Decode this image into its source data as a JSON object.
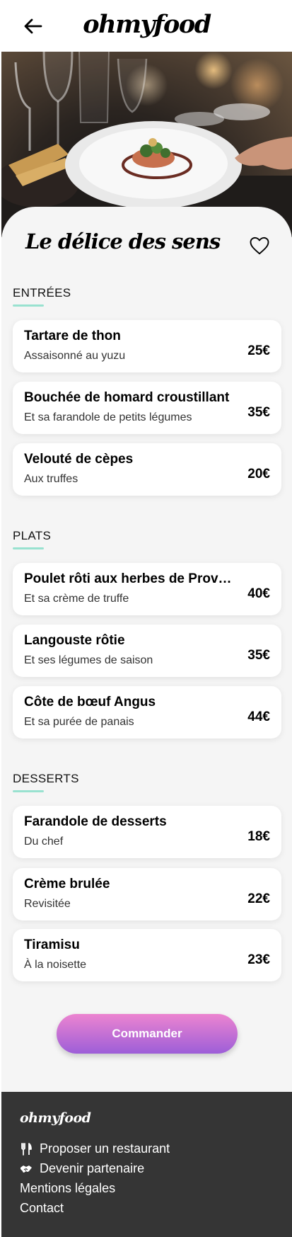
{
  "header": {
    "logo": "ohmyfood",
    "back_icon": "arrow-left-icon"
  },
  "restaurant": {
    "name": "Le délice des sens",
    "favorite_icon": "heart-outline-icon"
  },
  "sections": [
    {
      "title": "Entrées",
      "dishes": [
        {
          "name": "Tartare de thon",
          "description": "Assaisonné au yuzu",
          "price": "25€"
        },
        {
          "name": "Bouchée de homard croustillant",
          "description": "Et sa farandole de petits légumes",
          "price": "35€"
        },
        {
          "name": "Velouté de cèpes",
          "description": "Aux truffes",
          "price": "20€"
        }
      ]
    },
    {
      "title": "Plats",
      "dishes": [
        {
          "name": "Poulet rôti aux herbes de Provence",
          "description": "Et sa crème de truffe",
          "price": "40€"
        },
        {
          "name": "Langouste rôtie",
          "description": "Et ses légumes de saison",
          "price": "35€"
        },
        {
          "name": "Côte de bœuf Angus",
          "description": "Et sa purée de panais",
          "price": "44€"
        }
      ]
    },
    {
      "title": "Desserts",
      "dishes": [
        {
          "name": "Farandole de desserts",
          "description": "Du chef",
          "price": "18€"
        },
        {
          "name": "Crème brulée",
          "description": "Revisitée",
          "price": "22€"
        },
        {
          "name": "Tiramisu",
          "description": "À la noisette",
          "price": "23€"
        }
      ]
    }
  ],
  "order_button": {
    "label": "Commander"
  },
  "footer": {
    "logo": "ohmyfood",
    "links": [
      {
        "label": "Proposer un restaurant",
        "icon": "utensils-icon"
      },
      {
        "label": "Devenir partenaire",
        "icon": "handshake-icon"
      },
      {
        "label": "Mentions légales"
      },
      {
        "label": "Contact"
      }
    ]
  },
  "colors": {
    "accent_underline": "#99e2d0",
    "button_gradient_top": "#ec84d0",
    "button_gradient_bottom": "#9d5ed8",
    "footer_bg": "#353535",
    "page_bg": "#f5f5f5"
  }
}
